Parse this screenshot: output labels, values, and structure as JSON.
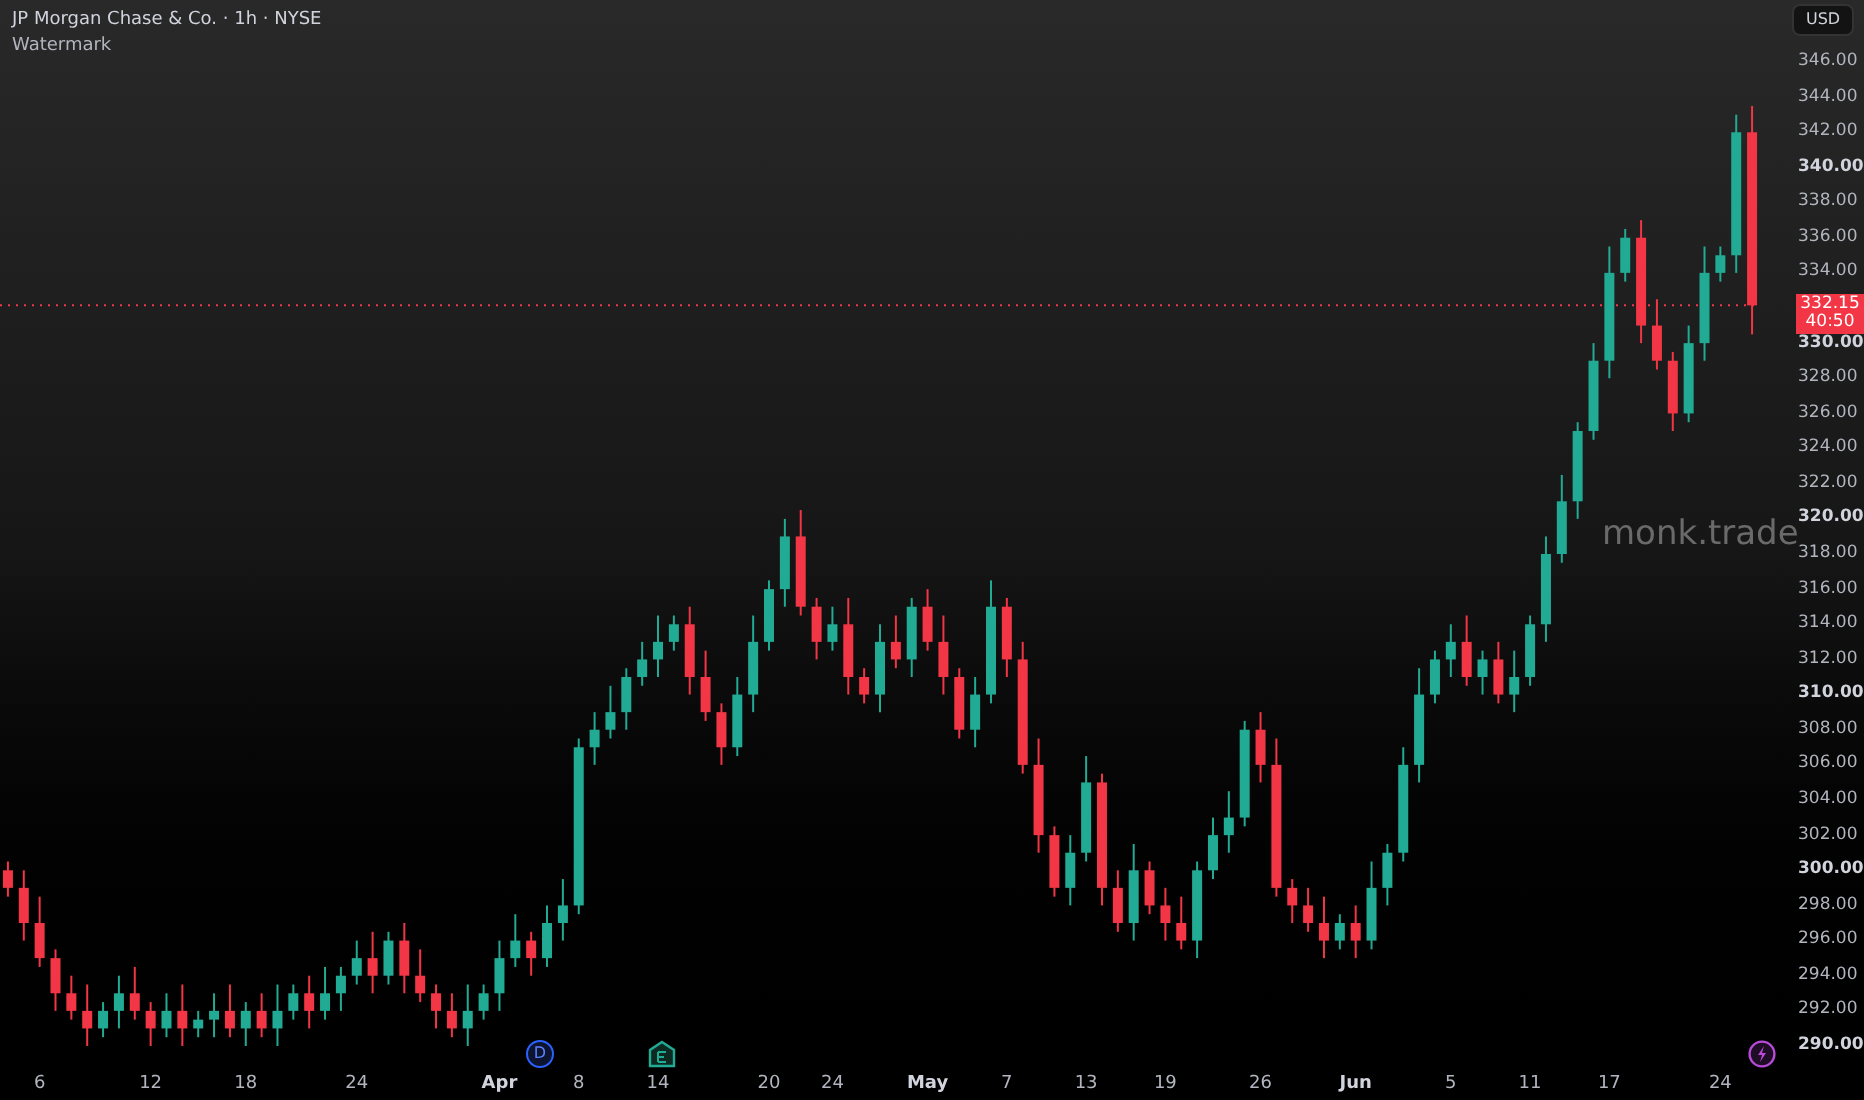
{
  "legend": {
    "title": "JP Morgan Chase & Co. · 1h · NYSE",
    "indicator": "Watermark"
  },
  "currency_button": "USD",
  "watermark_text": "monk.trade",
  "last_price": {
    "price": "332.15",
    "countdown": "40:50"
  },
  "event_markers": [
    {
      "kind": "dividend",
      "label": "D"
    },
    {
      "kind": "earnings"
    },
    {
      "kind": "news"
    }
  ],
  "chart_data": {
    "type": "candlestick",
    "ylim": [
      290,
      346
    ],
    "ref_lines": [
      {
        "axis": "y",
        "value": 332.15,
        "color": "#f23645"
      }
    ],
    "categories": [
      null,
      null,
      "6",
      null,
      null,
      null,
      null,
      null,
      null,
      "12",
      null,
      null,
      null,
      null,
      null,
      "18",
      null,
      null,
      null,
      null,
      null,
      null,
      "24",
      null,
      null,
      null,
      null,
      null,
      null,
      null,
      null,
      "Apr",
      null,
      null,
      null,
      null,
      "8",
      null,
      null,
      null,
      null,
      "14",
      null,
      null,
      null,
      null,
      null,
      null,
      "20",
      null,
      null,
      null,
      "24",
      null,
      null,
      null,
      null,
      null,
      "May",
      null,
      null,
      null,
      null,
      "7",
      null,
      null,
      null,
      null,
      "13",
      null,
      null,
      null,
      null,
      "19",
      null,
      null,
      null,
      null,
      null,
      "26",
      null,
      null,
      null,
      null,
      null,
      "Jun",
      null,
      null,
      null,
      null,
      null,
      "5",
      null,
      null,
      null,
      null,
      "11",
      null,
      null,
      null,
      null,
      "17",
      null,
      null,
      null,
      null,
      null,
      null,
      "24",
      null,
      null
    ],
    "ohlc": [
      [
        300,
        300.5,
        298.5,
        299
      ],
      [
        299,
        300,
        296,
        297
      ],
      [
        297,
        298.5,
        294.5,
        295
      ],
      [
        295,
        295.5,
        292,
        293
      ],
      [
        293,
        294,
        291.5,
        292
      ],
      [
        292,
        293.5,
        290,
        291
      ],
      [
        291,
        292.5,
        290.5,
        292
      ],
      [
        292,
        294,
        291,
        293
      ],
      [
        293,
        294.5,
        291.5,
        292
      ],
      [
        292,
        292.5,
        290,
        291
      ],
      [
        291,
        293,
        290.5,
        292
      ],
      [
        292,
        293.5,
        290,
        291
      ],
      [
        291,
        292,
        290.5,
        291.5
      ],
      [
        291.5,
        293,
        290.5,
        292
      ],
      [
        292,
        293.5,
        290.5,
        291
      ],
      [
        291,
        292.5,
        290,
        292
      ],
      [
        292,
        293,
        290.5,
        291
      ],
      [
        291,
        293.5,
        290,
        292
      ],
      [
        292,
        293.5,
        291.5,
        293
      ],
      [
        293,
        294,
        291,
        292
      ],
      [
        292,
        294.5,
        291.5,
        293
      ],
      [
        293,
        294.5,
        292,
        294
      ],
      [
        294,
        296,
        293.5,
        295
      ],
      [
        295,
        296.5,
        293,
        294
      ],
      [
        294,
        296.5,
        293.5,
        296
      ],
      [
        296,
        297,
        293,
        294
      ],
      [
        294,
        295.5,
        292.5,
        293
      ],
      [
        293,
        293.5,
        291,
        292
      ],
      [
        292,
        293,
        290.5,
        291
      ],
      [
        291,
        293.5,
        290,
        292
      ],
      [
        292,
        293.5,
        291.5,
        293
      ],
      [
        293,
        296,
        292,
        295
      ],
      [
        295,
        297.5,
        294.5,
        296
      ],
      [
        296,
        296.5,
        294,
        295
      ],
      [
        295,
        298,
        294.5,
        297
      ],
      [
        297,
        299.5,
        296,
        298
      ],
      [
        298,
        307.5,
        297.5,
        307
      ],
      [
        307,
        309,
        306,
        308
      ],
      [
        308,
        310.5,
        307.5,
        309
      ],
      [
        309,
        311.5,
        308,
        311
      ],
      [
        311,
        313,
        310.5,
        312
      ],
      [
        312,
        314.5,
        311,
        313
      ],
      [
        313,
        314.5,
        312.5,
        314
      ],
      [
        314,
        315,
        310,
        311
      ],
      [
        311,
        312.5,
        308.5,
        309
      ],
      [
        309,
        309.5,
        306,
        307
      ],
      [
        307,
        311,
        306.5,
        310
      ],
      [
        310,
        314.5,
        309,
        313
      ],
      [
        313,
        316.5,
        312.5,
        316
      ],
      [
        316,
        320,
        315,
        319
      ],
      [
        319,
        320.5,
        314.5,
        315
      ],
      [
        315,
        315.5,
        312,
        313
      ],
      [
        313,
        315,
        312.5,
        314
      ],
      [
        314,
        315.5,
        310,
        311
      ],
      [
        311,
        311.5,
        309.5,
        310
      ],
      [
        310,
        314,
        309,
        313
      ],
      [
        313,
        314.5,
        311.5,
        312
      ],
      [
        312,
        315.5,
        311,
        315
      ],
      [
        315,
        316,
        312.5,
        313
      ],
      [
        313,
        314.5,
        310,
        311
      ],
      [
        311,
        311.5,
        307.5,
        308
      ],
      [
        308,
        311,
        307,
        310
      ],
      [
        310,
        316.5,
        309.5,
        315
      ],
      [
        315,
        315.5,
        311,
        312
      ],
      [
        312,
        313,
        305.5,
        306
      ],
      [
        306,
        307.5,
        301,
        302
      ],
      [
        302,
        302.5,
        298.5,
        299
      ],
      [
        299,
        302,
        298,
        301
      ],
      [
        301,
        306.5,
        300.5,
        305
      ],
      [
        305,
        305.5,
        298,
        299
      ],
      [
        299,
        300,
        296.5,
        297
      ],
      [
        297,
        301.5,
        296,
        300
      ],
      [
        300,
        300.5,
        297.5,
        298
      ],
      [
        298,
        299,
        296,
        297
      ],
      [
        297,
        298.5,
        295.5,
        296
      ],
      [
        296,
        300.5,
        295,
        300
      ],
      [
        300,
        303,
        299.5,
        302
      ],
      [
        302,
        304.5,
        301,
        303
      ],
      [
        303,
        308.5,
        302.5,
        308
      ],
      [
        308,
        309,
        305,
        306
      ],
      [
        306,
        307.5,
        298.5,
        299
      ],
      [
        299,
        299.5,
        297,
        298
      ],
      [
        298,
        299,
        296.5,
        297
      ],
      [
        297,
        298.5,
        295,
        296
      ],
      [
        296,
        297.5,
        295.5,
        297
      ],
      [
        297,
        298,
        295,
        296
      ],
      [
        296,
        300.5,
        295.5,
        299
      ],
      [
        299,
        301.5,
        298,
        301
      ],
      [
        301,
        307,
        300.5,
        306
      ],
      [
        306,
        311.5,
        305,
        310
      ],
      [
        310,
        312.5,
        309.5,
        312
      ],
      [
        312,
        314,
        311,
        313
      ],
      [
        313,
        314.5,
        310.5,
        311
      ],
      [
        311,
        312.5,
        310,
        312
      ],
      [
        312,
        313,
        309.5,
        310
      ],
      [
        310,
        312.5,
        309,
        311
      ],
      [
        311,
        314.5,
        310.5,
        314
      ],
      [
        314,
        319,
        313,
        318
      ],
      [
        318,
        322.5,
        317.5,
        321
      ],
      [
        321,
        325.5,
        320,
        325
      ],
      [
        325,
        330,
        324.5,
        329
      ],
      [
        329,
        335.5,
        328,
        334
      ],
      [
        334,
        336.5,
        333.5,
        336
      ],
      [
        336,
        337,
        330,
        331
      ],
      [
        331,
        332.5,
        328.5,
        329
      ],
      [
        329,
        329.5,
        325,
        326
      ],
      [
        326,
        331,
        325.5,
        330
      ],
      [
        330,
        335.5,
        329,
        334
      ],
      [
        334,
        335.5,
        333.5,
        335
      ],
      [
        335,
        343,
        334,
        342
      ],
      [
        342,
        343.5,
        330.5,
        332.15
      ]
    ],
    "yticks": [
      {
        "value": 346,
        "label": "346.00"
      },
      {
        "value": 344,
        "label": "344.00"
      },
      {
        "value": 342,
        "label": "342.00"
      },
      {
        "value": 340,
        "label": "340.00"
      },
      {
        "value": 338,
        "label": "338.00"
      },
      {
        "value": 336,
        "label": "336.00"
      },
      {
        "value": 334,
        "label": "334.00"
      },
      {
        "value": 330,
        "label": "330.00"
      },
      {
        "value": 328,
        "label": "328.00"
      },
      {
        "value": 326,
        "label": "326.00"
      },
      {
        "value": 324,
        "label": "324.00"
      },
      {
        "value": 322,
        "label": "322.00"
      },
      {
        "value": 320,
        "label": "320.00"
      },
      {
        "value": 318,
        "label": "318.00"
      },
      {
        "value": 316,
        "label": "316.00"
      },
      {
        "value": 314,
        "label": "314.00"
      },
      {
        "value": 312,
        "label": "312.00"
      },
      {
        "value": 310,
        "label": "310.00"
      },
      {
        "value": 308,
        "label": "308.00"
      },
      {
        "value": 306,
        "label": "306.00"
      },
      {
        "value": 304,
        "label": "304.00"
      },
      {
        "value": 302,
        "label": "302.00"
      },
      {
        "value": 300,
        "label": "300.00"
      },
      {
        "value": 298,
        "label": "298.00"
      },
      {
        "value": 296,
        "label": "296.00"
      },
      {
        "value": 294,
        "label": "294.00"
      },
      {
        "value": 292,
        "label": "292.00"
      },
      {
        "value": 290,
        "label": "290.00"
      }
    ]
  }
}
